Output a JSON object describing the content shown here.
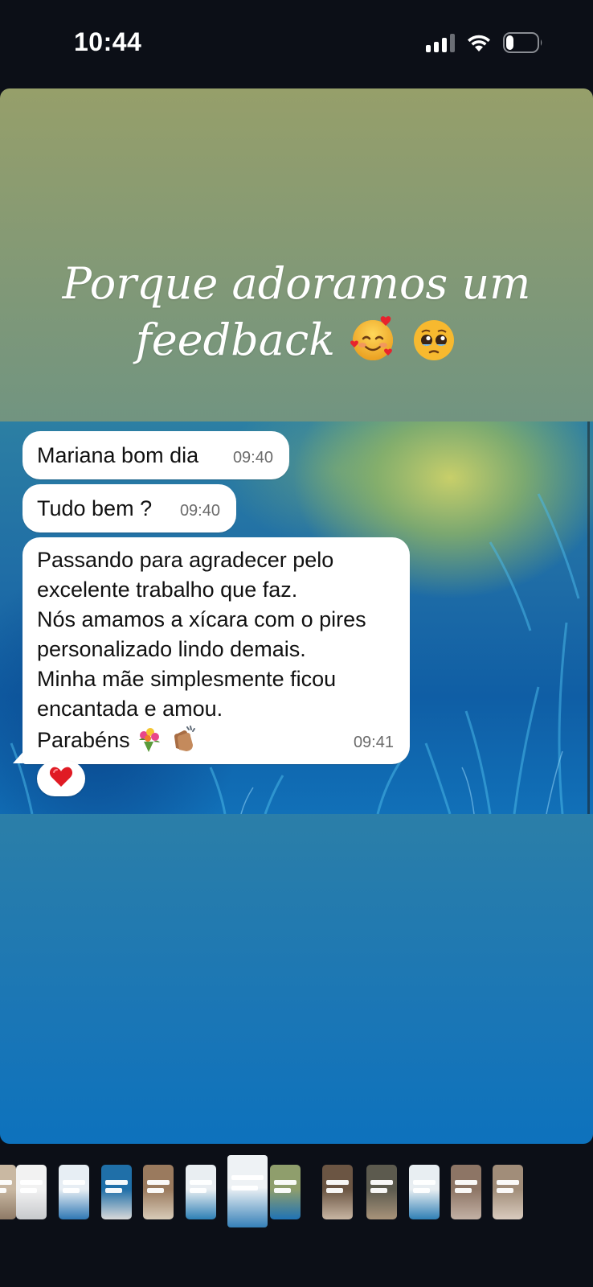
{
  "status_bar": {
    "time": "10:44",
    "signal_icon": "cellular-signal-icon",
    "wifi_icon": "wifi-icon",
    "battery_icon": "battery-icon",
    "battery_level": 0.25
  },
  "story": {
    "caption_line1": "Porque adoramos um",
    "caption_line2": "feedback",
    "caption_emojis": [
      "smiling-face-with-hearts-icon",
      "pleading-face-icon"
    ]
  },
  "chat": {
    "messages": [
      {
        "text": "Mariana bom dia",
        "time": "09:40"
      },
      {
        "text": "Tudo bem ?",
        "time": "09:40"
      },
      {
        "text": "Passando para agradecer pelo\nexcelente trabalho que faz.\nNós amamos a xícara com o pires\npersonalizado lindo demais.\nMinha mãe simplesmente ficou\nencantada e amou.\nParabéns",
        "time": "09:41",
        "emojis": [
          "bouquet-icon",
          "clapping-hands-icon"
        ]
      }
    ],
    "reaction_icon": "red-heart-icon"
  },
  "thumbnails": {
    "count": 13,
    "active_index": 6
  },
  "colors": {
    "background": "#0c0f17",
    "bubble": "#ffffff",
    "timestamp": "#6b6b6b"
  }
}
